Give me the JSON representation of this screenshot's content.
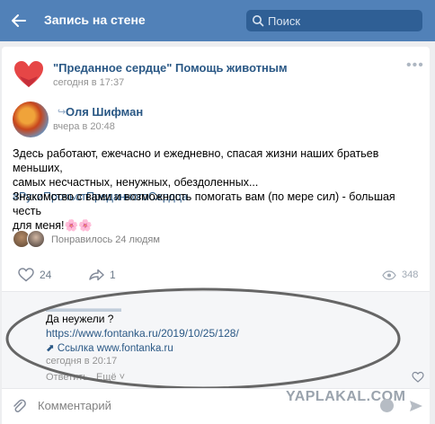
{
  "header": {
    "title": "Запись на стене",
    "search_placeholder": "Поиск"
  },
  "post": {
    "group_name": "\"Преданное сердце\" Помощь животным",
    "time": "сегодня в 17:37",
    "more": "•••",
    "repost": {
      "author": "Оля Шифман",
      "time": "вчера в 20:48"
    },
    "text_line1": "Здесь работают, ежечасно и ежедневно, спасая жизни наших братьев меньших,",
    "text_line2": "самых несчастных, ненужных, обездоленных...",
    "hashtag": "#РукиПрочьотПреданногоСердца",
    "text2_line1": "Знакомство с вами и возможность помогать вам (по мере сил) - большая честь",
    "text2_line2": "для меня!🌸🌸",
    "liked_by": "Понравилось 24 людям",
    "likes": "24",
    "shares": "1",
    "views": "348"
  },
  "comment": {
    "text": "Да неужели ?",
    "link": "https://www.fontanka.ru/2019/10/25/128/",
    "snippet_label": "Ссылка",
    "snippet_domain": "www.fontanka.ru",
    "time": "сегодня в 20:17",
    "reply": "Ответить",
    "more": "Ещё"
  },
  "composer": {
    "placeholder": "Комментарий"
  },
  "watermark": "YAPLAKAL.COM",
  "colors": {
    "topbar": "#5181b8",
    "link": "#2a5885",
    "accent_heart": "#e64646"
  }
}
